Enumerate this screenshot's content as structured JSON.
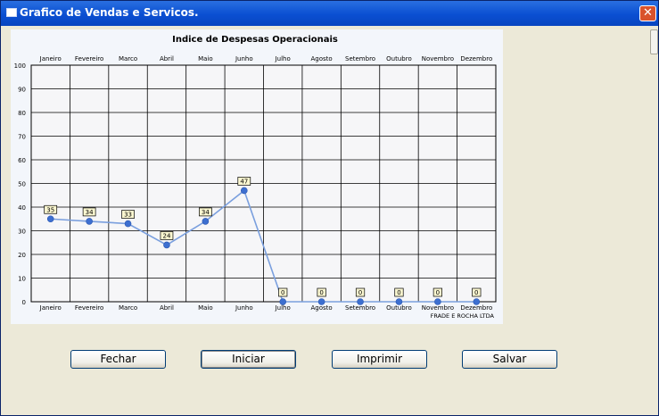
{
  "window": {
    "title": "Grafico de Vendas e Servicos.",
    "close_label": "✕"
  },
  "chart_data": {
    "type": "line",
    "title": "Indice de Despesas Operacionais",
    "categories": [
      "Janeiro",
      "Fevereiro",
      "Marco",
      "Abril",
      "Maio",
      "Junho",
      "Julho",
      "Agosto",
      "Setembro",
      "Outubro",
      "Novembro",
      "Dezembro"
    ],
    "values": [
      35,
      34,
      33,
      24,
      34,
      47,
      0,
      0,
      0,
      0,
      0,
      0
    ],
    "yticks": [
      "0",
      "10",
      "20",
      "30",
      "40",
      "50",
      "60",
      "70",
      "80",
      "90",
      "100"
    ],
    "ylim": [
      0,
      100
    ],
    "grid": true,
    "footer": "FRADE E ROCHA LTDA",
    "colors": {
      "line": "#7a9fde",
      "marker": "#3d6fd0"
    }
  },
  "buttons": {
    "close": "Fechar",
    "start": "Iniciar",
    "print": "Imprimir",
    "save": "Salvar"
  }
}
